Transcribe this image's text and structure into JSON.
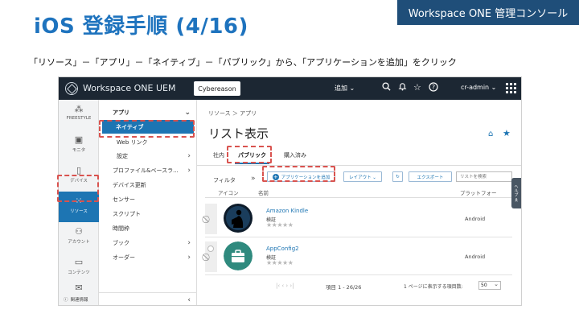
{
  "slide": {
    "title": "iOS 登録手順 (4/16)",
    "brand": "Workspace ONE 管理コンソール",
    "instruction": "「リソース」－「アプリ」－「ネイティブ」－「パブリック」から、「アプリケーションを追加」をクリック"
  },
  "topbar": {
    "product": "Workspace ONE UEM",
    "org": "Cybereason",
    "add_menu": "追加 ⌄",
    "user": "cr-admin ⌄"
  },
  "rail": {
    "items": [
      {
        "label": "FREESTYLE",
        "icon": "freestyle-icon"
      },
      {
        "label": "モニタ",
        "icon": "monitor-icon"
      },
      {
        "label": "デバイス",
        "icon": "device-icon"
      },
      {
        "label": "リソース",
        "icon": "resources-icon"
      },
      {
        "label": "アカウント",
        "icon": "accounts-icon"
      },
      {
        "label": "コンテンツ",
        "icon": "content-icon"
      },
      {
        "label": "Eメール",
        "icon": "email-icon"
      },
      {
        "label": "",
        "icon": "phone-icon"
      }
    ],
    "bottom_label": "関連情報"
  },
  "subnav": {
    "items": [
      {
        "label": "アプリ",
        "type": "section",
        "chevron": "⌄"
      },
      {
        "label": "ネイティブ",
        "type": "active"
      },
      {
        "label": "Web リンク",
        "type": "child"
      },
      {
        "label": "設定",
        "type": "child",
        "chevron": "›"
      },
      {
        "label": "プロファイル&ベースラ...",
        "type": "item",
        "chevron": "›"
      },
      {
        "label": "デバイス更新",
        "type": "item"
      },
      {
        "label": "センサー",
        "type": "item"
      },
      {
        "label": "スクリプト",
        "type": "item"
      },
      {
        "label": "時間枠",
        "type": "item"
      },
      {
        "label": "ブック",
        "type": "item",
        "chevron": "›"
      },
      {
        "label": "オーダー",
        "type": "item",
        "chevron": "›"
      }
    ],
    "collapse": "‹"
  },
  "content": {
    "breadcrumb": "リソース ＞ アプリ",
    "title": "リスト表示",
    "tabs": [
      "社内",
      "パブリック",
      "購入済み"
    ],
    "filter_label": "フィルタ",
    "expand": "»",
    "add_app_button": "アプリケーションを追加",
    "layout_button": "レイアウト ⌄",
    "export_button": "エクスポート",
    "search_placeholder": "リストを検索",
    "columns": [
      "アイコン",
      "名前",
      "プラットフォー"
    ],
    "rows": [
      {
        "name": "Amazon Kindle",
        "status": "検証",
        "rating": "★★★★★",
        "platform": "Android"
      },
      {
        "name": "AppConfig2",
        "status": "検証",
        "rating": "★★★★★",
        "platform": "Android"
      }
    ],
    "pager": {
      "nav": "|‹   ‹   ›   ›|",
      "range": "項目 1 - 26/26",
      "per_page_label": "1 ページに表示する項目数:",
      "per_page_value": "50"
    }
  },
  "side_tab": "ヘルプ ≪",
  "colors": {
    "title_blue": "#1e73be",
    "brand_bg": "#1f4e79",
    "topbar_bg": "#1c2733",
    "accent": "#1d75b3",
    "callout": "#d9534f"
  }
}
